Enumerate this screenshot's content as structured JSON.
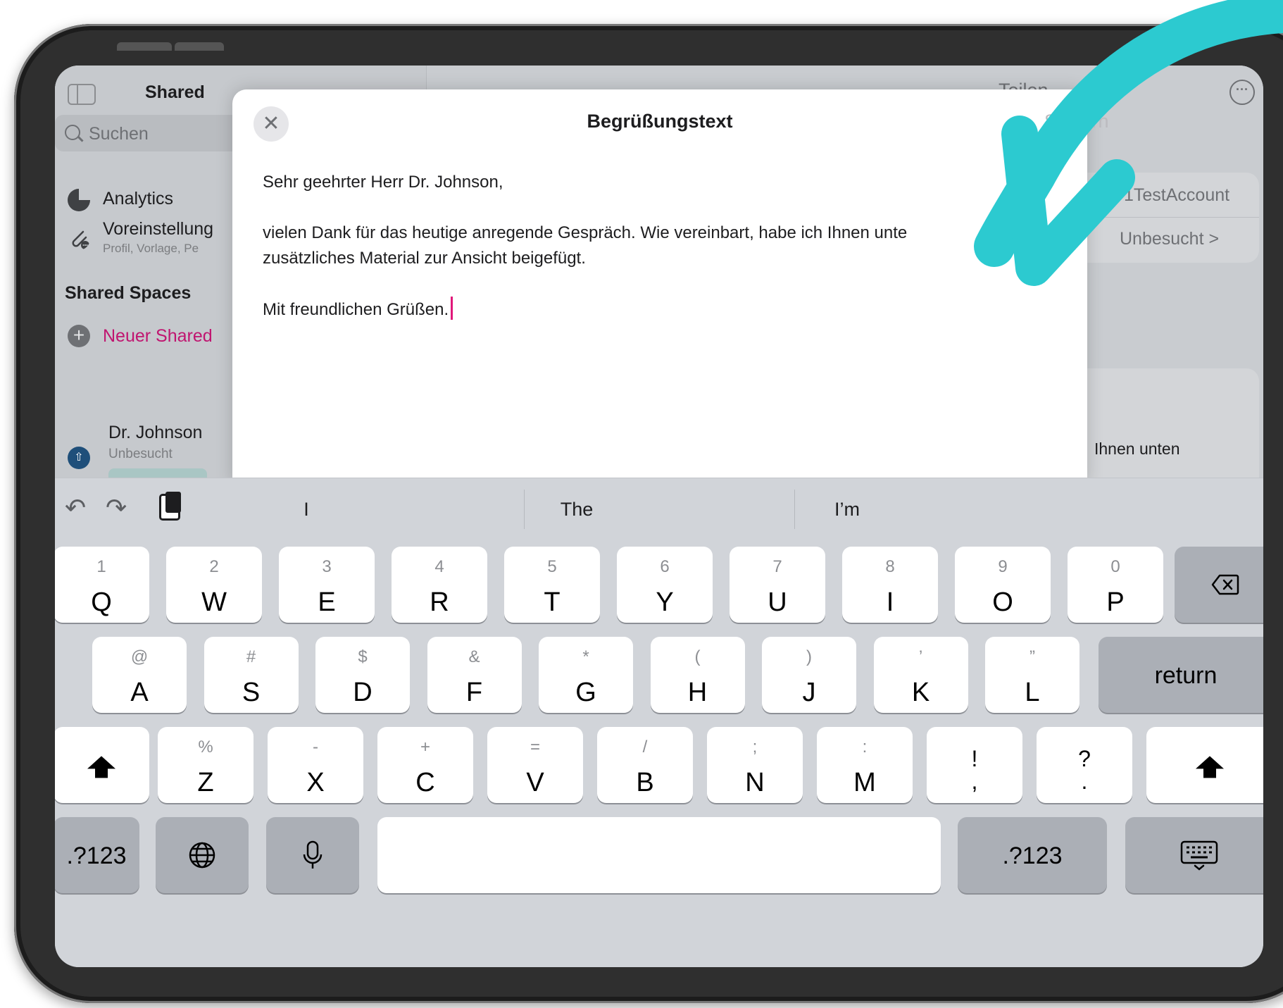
{
  "background_app": {
    "sidebar_title": "Shared ",
    "search_placeholder": "Suchen",
    "items": [
      {
        "label": "Analytics",
        "icon": "pie-chart-icon"
      },
      {
        "label": "Voreinstellung",
        "sublabel": "Profil, Vorlage, Pe",
        "icon": "paperclip-icon"
      }
    ],
    "section_title": "Shared Spaces",
    "new_shared_label": "Neuer Shared",
    "person": {
      "name": "Dr. Johnson",
      "status": "Unbesucht"
    },
    "detail_header_share": "Teilen",
    "detail_account": "1TestAccount",
    "detail_status": "Unbesucht  >",
    "detail_snippet": "Ihnen unten"
  },
  "modal": {
    "title": "Begrüßungstext",
    "save_label": "Sichern",
    "close_glyph": "✕",
    "body_lines": [
      "Sehr geehrter Herr Dr. Johnson,",
      "vielen Dank für das heutige anregende Gespräch. Wie vereinbart, habe ich Ihnen unte",
      "zusätzliches Material zur Ansicht beigefügt.",
      "Mit freundlichen Grüßen."
    ]
  },
  "keyboard": {
    "suggestions": [
      "I",
      "The",
      "I’m"
    ],
    "row1": [
      {
        "sym": "1",
        "main": "Q"
      },
      {
        "sym": "2",
        "main": "W"
      },
      {
        "sym": "3",
        "main": "E"
      },
      {
        "sym": "4",
        "main": "R"
      },
      {
        "sym": "5",
        "main": "T"
      },
      {
        "sym": "6",
        "main": "Y"
      },
      {
        "sym": "7",
        "main": "U"
      },
      {
        "sym": "8",
        "main": "I"
      },
      {
        "sym": "9",
        "main": "O"
      },
      {
        "sym": "0",
        "main": "P"
      }
    ],
    "row2": [
      {
        "sym": "@",
        "main": "A"
      },
      {
        "sym": "#",
        "main": "S"
      },
      {
        "sym": "$",
        "main": "D"
      },
      {
        "sym": "&",
        "main": "F"
      },
      {
        "sym": "*",
        "main": "G"
      },
      {
        "sym": "(",
        "main": "H"
      },
      {
        "sym": ")",
        "main": "J"
      },
      {
        "sym": "’",
        "main": "K"
      },
      {
        "sym": "”",
        "main": "L"
      }
    ],
    "row3": [
      {
        "sym": "%",
        "main": "Z"
      },
      {
        "sym": "-",
        "main": "X"
      },
      {
        "sym": "+",
        "main": "C"
      },
      {
        "sym": "=",
        "main": "V"
      },
      {
        "sym": "/",
        "main": "B"
      },
      {
        "sym": ";",
        "main": "N"
      },
      {
        "sym": ":",
        "main": "M"
      }
    ],
    "punct_keys": [
      {
        "top": "!",
        "bottom": ","
      },
      {
        "top": "?",
        "bottom": "."
      }
    ],
    "return_label": "return",
    "numbers_label": ".?123",
    "space_label": ""
  },
  "colors": {
    "accent_pink": "#e0187a",
    "arrow_teal": "#2ccad0",
    "keyboard_bg": "#d1d4d9"
  }
}
